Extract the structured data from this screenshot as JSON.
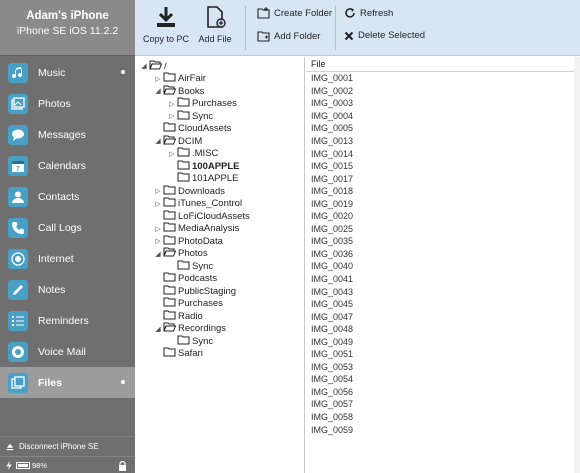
{
  "device": {
    "name": "Adam's iPhone",
    "model": "iPhone SE iOS 11.2.2"
  },
  "sidebar": {
    "items": [
      {
        "label": "Music",
        "icon": "music-icon",
        "dot": true
      },
      {
        "label": "Photos",
        "icon": "photos-icon"
      },
      {
        "label": "Messages",
        "icon": "messages-icon"
      },
      {
        "label": "Calendars",
        "icon": "calendar-icon"
      },
      {
        "label": "Contacts",
        "icon": "contacts-icon"
      },
      {
        "label": "Call Logs",
        "icon": "phone-icon"
      },
      {
        "label": "Internet",
        "icon": "globe-icon"
      },
      {
        "label": "Notes",
        "icon": "notes-icon"
      },
      {
        "label": "Reminders",
        "icon": "reminders-icon"
      },
      {
        "label": "Voice Mail",
        "icon": "voicemail-icon"
      },
      {
        "label": "Files",
        "icon": "files-icon",
        "active": true,
        "dot": true
      }
    ],
    "disconnect_label": "Disconnect iPhone SE",
    "battery_label": "98%"
  },
  "toolbar": {
    "copy_to_pc": "Copy to PC",
    "add_file": "Add File",
    "create_folder": "Create Folder",
    "add_folder": "Add Folder",
    "refresh": "Refresh",
    "delete_selected": "Delete Selected"
  },
  "tree": [
    {
      "label": "/",
      "level": 0,
      "arrow": "open"
    },
    {
      "label": "AirFair",
      "level": 1,
      "arrow": "closed"
    },
    {
      "label": "Books",
      "level": 1,
      "arrow": "open"
    },
    {
      "label": "Purchases",
      "level": 2,
      "arrow": "closed"
    },
    {
      "label": "Sync",
      "level": 2,
      "arrow": "closed"
    },
    {
      "label": "CloudAssets",
      "level": 1,
      "arrow": "none"
    },
    {
      "label": "DCIM",
      "level": 1,
      "arrow": "open"
    },
    {
      "label": ".MISC",
      "level": 2,
      "arrow": "closed"
    },
    {
      "label": "100APPLE",
      "level": 2,
      "arrow": "none",
      "bold": true
    },
    {
      "label": "101APPLE",
      "level": 2,
      "arrow": "none"
    },
    {
      "label": "Downloads",
      "level": 1,
      "arrow": "closed"
    },
    {
      "label": "iTunes_Control",
      "level": 1,
      "arrow": "closed"
    },
    {
      "label": "LoFiCloudAssets",
      "level": 1,
      "arrow": "none"
    },
    {
      "label": "MediaAnalysis",
      "level": 1,
      "arrow": "closed"
    },
    {
      "label": "PhotoData",
      "level": 1,
      "arrow": "closed"
    },
    {
      "label": "Photos",
      "level": 1,
      "arrow": "open"
    },
    {
      "label": "Sync",
      "level": 2,
      "arrow": "none"
    },
    {
      "label": "Podcasts",
      "level": 1,
      "arrow": "none"
    },
    {
      "label": "PublicStaging",
      "level": 1,
      "arrow": "none"
    },
    {
      "label": "Purchases",
      "level": 1,
      "arrow": "none"
    },
    {
      "label": "Radio",
      "level": 1,
      "arrow": "none"
    },
    {
      "label": "Recordings",
      "level": 1,
      "arrow": "open"
    },
    {
      "label": "Sync",
      "level": 2,
      "arrow": "none"
    },
    {
      "label": "Safari",
      "level": 1,
      "arrow": "none"
    }
  ],
  "files": {
    "header": "File",
    "rows": [
      "IMG_0001",
      "IMG_0002",
      "IMG_0003",
      "IMG_0004",
      "IMG_0005",
      "IMG_0013",
      "IMG_0014",
      "IMG_0015",
      "IMG_0017",
      "IMG_0018",
      "IMG_0019",
      "IMG_0020",
      "IMG_0025",
      "IMG_0035",
      "IMG_0036",
      "IMG_0040",
      "IMG_0041",
      "IMG_0043",
      "IMG_0045",
      "IMG_0047",
      "IMG_0048",
      "IMG_0049",
      "IMG_0051",
      "IMG_0053",
      "IMG_0054",
      "IMG_0056",
      "IMG_0057",
      "IMG_0058",
      "IMG_0059"
    ]
  },
  "colors": {
    "sidebar": "#6f6f6f",
    "accent_icon": "#4a9fc4",
    "toolbar": "#d8e6f4"
  }
}
